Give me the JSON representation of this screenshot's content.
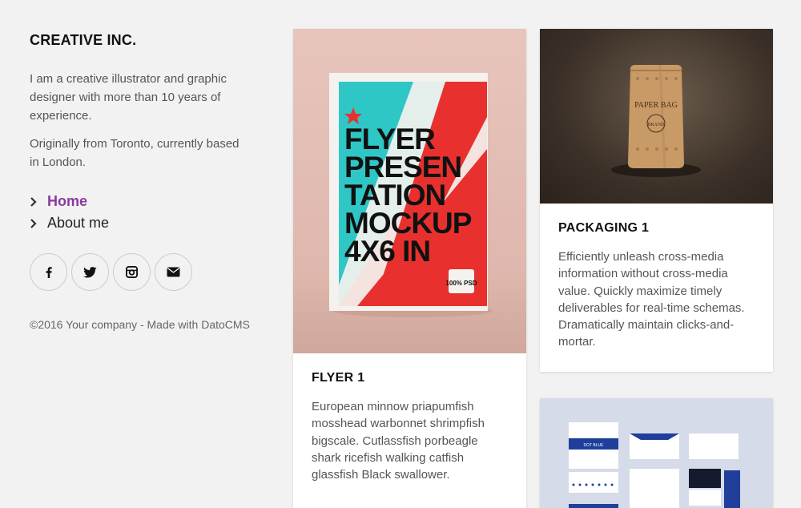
{
  "sidebar": {
    "brand": "CREATIVE INC.",
    "bio": [
      "I am a creative illustrator and graphic designer with more than 10 years of experience.",
      "Originally from Toronto, currently based in London."
    ],
    "nav": [
      {
        "label": "Home",
        "active": true
      },
      {
        "label": "About me",
        "active": false
      }
    ],
    "social": [
      "facebook-icon",
      "twitter-icon",
      "instagram-icon",
      "email-icon"
    ],
    "footer": "©2016 Your company - Made with DatoCMS"
  },
  "cards": [
    {
      "title": "FLYER 1",
      "description": "European minnow priapumfish mosshead warbonnet shrimpfish bigscale. Cutlassfish porbeagle shark ricefish walking catfish glassfish Black swallower.",
      "image": {
        "poster_lines": [
          "FLYER",
          "PRESEN",
          "TATION",
          "MOCKUP",
          "4X6 IN"
        ],
        "badge": "100% PSD"
      }
    },
    {
      "title": "PACKAGING 1",
      "description": "Efficiently unleash cross-media information without cross-media value. Quickly maximize timely deliverables for real-time schemas. Dramatically maintain clicks-and-mortar.",
      "image": {
        "bag_label": "PAPER BAG",
        "bag_sub": "BRAND"
      }
    },
    {
      "title": "",
      "description": "",
      "image": {
        "brand_mark": "DOT BLUE"
      }
    }
  ],
  "colors": {
    "background": "#f2f2f2",
    "accent": "#8a3a9e",
    "text": "#555555",
    "heading": "#111111"
  }
}
